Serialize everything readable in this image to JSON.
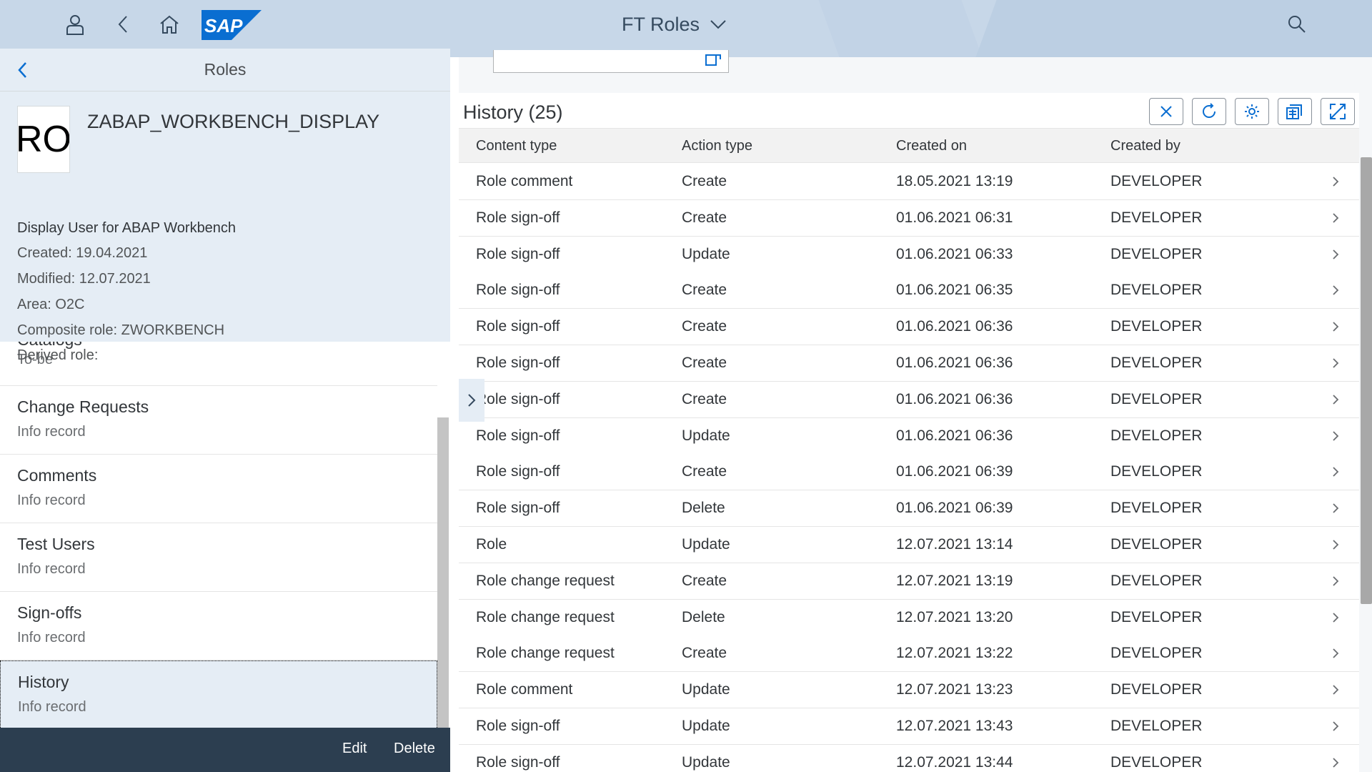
{
  "shell": {
    "title": "FT Roles",
    "logo_text": "SAP",
    "icons": [
      "user-icon",
      "back-icon",
      "home-icon",
      "search-icon"
    ]
  },
  "master": {
    "title": "Roles",
    "avatar_initials": "RO",
    "object_title": "ZABAP_WORKBENCH_DISPLAY",
    "description": "Display User for ABAP Workbench",
    "created": "Created: 19.04.2021",
    "modified": "Modified: 12.07.2021",
    "area": "Area: O2C",
    "composite_role": "Composite role: ZWORKBENCH",
    "derived_role": "Derived role:",
    "items": [
      {
        "title": "Catalogs",
        "subtitle": "To-be"
      },
      {
        "title": "Change Requests",
        "subtitle": "Info record"
      },
      {
        "title": "Comments",
        "subtitle": "Info record"
      },
      {
        "title": "Test Users",
        "subtitle": "Info record"
      },
      {
        "title": "Sign-offs",
        "subtitle": "Info record"
      },
      {
        "title": "History",
        "subtitle": "Info record"
      }
    ],
    "footer": {
      "edit": "Edit",
      "delete": "Delete"
    }
  },
  "detail": {
    "table_title": "History (25)",
    "columns": [
      "Content type",
      "Action type",
      "Created on",
      "Created by"
    ],
    "rows": [
      [
        "Role comment",
        "Create",
        "18.05.2021 13:19",
        "DEVELOPER"
      ],
      [
        "Role sign-off",
        "Create",
        "01.06.2021 06:31",
        "DEVELOPER"
      ],
      [
        "Role sign-off",
        "Update",
        "01.06.2021 06:33",
        "DEVELOPER"
      ],
      [
        "Role sign-off",
        "Create",
        "01.06.2021 06:35",
        "DEVELOPER"
      ],
      [
        "Role sign-off",
        "Create",
        "01.06.2021 06:36",
        "DEVELOPER"
      ],
      [
        "Role sign-off",
        "Create",
        "01.06.2021 06:36",
        "DEVELOPER"
      ],
      [
        "Role sign-off",
        "Create",
        "01.06.2021 06:36",
        "DEVELOPER"
      ],
      [
        "Role sign-off",
        "Update",
        "01.06.2021 06:36",
        "DEVELOPER"
      ],
      [
        "Role sign-off",
        "Create",
        "01.06.2021 06:39",
        "DEVELOPER"
      ],
      [
        "Role sign-off",
        "Delete",
        "01.06.2021 06:39",
        "DEVELOPER"
      ],
      [
        "Role",
        "Update",
        "12.07.2021 13:14",
        "DEVELOPER"
      ],
      [
        "Role change request",
        "Create",
        "12.07.2021 13:19",
        "DEVELOPER"
      ],
      [
        "Role change request",
        "Delete",
        "12.07.2021 13:20",
        "DEVELOPER"
      ],
      [
        "Role change request",
        "Create",
        "12.07.2021 13:22",
        "DEVELOPER"
      ],
      [
        "Role comment",
        "Update",
        "12.07.2021 13:23",
        "DEVELOPER"
      ],
      [
        "Role sign-off",
        "Update",
        "12.07.2021 13:43",
        "DEVELOPER"
      ],
      [
        "Role sign-off",
        "Update",
        "12.07.2021 13:44",
        "DEVELOPER"
      ]
    ],
    "toolbar_icons": [
      "close-icon",
      "refresh-icon",
      "settings-icon",
      "export-icon",
      "fullscreen-icon"
    ]
  },
  "colors": {
    "shell_bg": "#c7d7e8",
    "header_bg": "#e5edf5",
    "accent": "#0a6ed1",
    "footer_bg": "#2c3e50"
  }
}
